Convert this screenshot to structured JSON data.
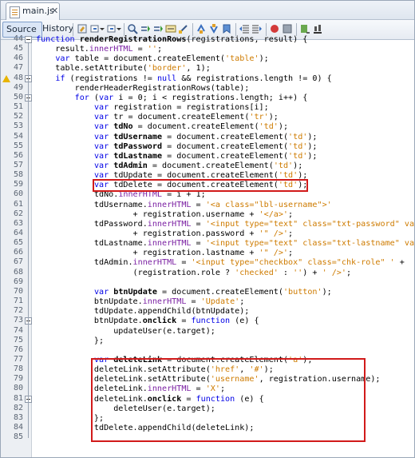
{
  "tab": {
    "filename": "main.js",
    "close": "✕"
  },
  "toolbar": {
    "source_label": "Source",
    "history_label": "History"
  },
  "lines": [
    {
      "n": "44",
      "html": "<span class='kw'>function</span> <span class='fn'>renderRegistrationRows</span>(registrations, result) {"
    },
    {
      "n": "45",
      "html": "    result.<span class='purple'>innerHTML</span> = <span class='str'>''</span>;"
    },
    {
      "n": "46",
      "html": "    <span class='kw'>var</span> table = document.createElement(<span class='str'>'table'</span>);"
    },
    {
      "n": "47",
      "html": "    table.setAttribute(<span class='str'>'border'</span>, 1);"
    },
    {
      "n": "48",
      "html": "    <span class='kw'>if</span> (registrations != <span class='kw'>null</span> &amp;&amp; registrations.length != 0) {"
    },
    {
      "n": "49",
      "html": "        renderHeaderRegistrationRows(table);"
    },
    {
      "n": "50",
      "html": "        <span class='kw'>for</span> (<span class='kw'>var</span> i = 0; i &lt; registrations.length; i++) {"
    },
    {
      "n": "51",
      "html": "            <span class='kw'>var</span> registration = registrations[i];"
    },
    {
      "n": "52",
      "html": "            <span class='kw'>var</span> tr = document.createElement(<span class='str'>'tr'</span>);"
    },
    {
      "n": "53",
      "html": "            <span class='kw'>var</span> <span class='bold'>tdNo</span> = document.createElement(<span class='str'>'td'</span>);"
    },
    {
      "n": "54",
      "html": "            <span class='kw'>var</span> <span class='bold'>tdUsername</span> = document.createElement(<span class='str'>'td'</span>);"
    },
    {
      "n": "55",
      "html": "            <span class='kw'>var</span> <span class='bold'>tdPassword</span> = document.createElement(<span class='str'>'td'</span>);"
    },
    {
      "n": "56",
      "html": "            <span class='kw'>var</span> <span class='bold'>tdLastname</span> = document.createElement(<span class='str'>'td'</span>);"
    },
    {
      "n": "57",
      "html": "            <span class='kw'>var</span> <span class='bold'>tdAdmin</span> = document.createElement(<span class='str'>'td'</span>);"
    },
    {
      "n": "58",
      "html": "            <span class='kw'>var</span> tdUpdate = document.createElement(<span class='str'>'td'</span>);"
    },
    {
      "n": "59",
      "html": "            <span class='kw'>var</span> tdDelete = document.createElement(<span class='str'>'td'</span>);"
    },
    {
      "n": "60",
      "html": "            tdNo.<span class='purple'>innerHTML</span> = i + 1;"
    },
    {
      "n": "61",
      "html": "            tdUsername.<span class='purple'>innerHTML</span> = <span class='str'>'&lt;a class=\"lbl-username\"&gt;'</span>"
    },
    {
      "n": "62",
      "html": "                    + registration.username + <span class='str'>'&lt;/a&gt;'</span>;"
    },
    {
      "n": "63",
      "html": "            tdPassword.<span class='purple'>innerHTML</span> = <span class='str'>'&lt;input type=\"text\" class=\"txt-password\" value=\"'</span>"
    },
    {
      "n": "64",
      "html": "                    + registration.password + <span class='str'>'\" /&gt;'</span>;"
    },
    {
      "n": "65",
      "html": "            tdLastname.<span class='purple'>innerHTML</span> = <span class='str'>'&lt;input type=\"text\" class=\"txt-lastname\" value=\"'</span>"
    },
    {
      "n": "66",
      "html": "                    + registration.lastname + <span class='str'>'\" /&gt;'</span>;"
    },
    {
      "n": "67",
      "html": "            tdAdmin.<span class='purple'>innerHTML</span> = <span class='str'>'&lt;input type=\"checkbox\" class=\"chk-role\" '</span> +"
    },
    {
      "n": "68",
      "html": "                    (registration.role ? <span class='str'>'checked'</span> : <span class='str'>''</span>) + <span class='str'>' /&gt;'</span>;"
    },
    {
      "n": "69",
      "html": ""
    },
    {
      "n": "70",
      "html": "            <span class='kw'>var</span> <span class='bold'>btnUpdate</span> = document.createElement(<span class='str'>'button'</span>);"
    },
    {
      "n": "71",
      "html": "            btnUpdate.<span class='purple'>innerHTML</span> = <span class='str'>'Update'</span>;"
    },
    {
      "n": "72",
      "html": "            tdUpdate.appendChild(btnUpdate);"
    },
    {
      "n": "73",
      "html": "            btnUpdate.<span class='bold'>onclick</span> = <span class='kw'>function</span> (e) {"
    },
    {
      "n": "74",
      "html": "                updateUser(e.target);"
    },
    {
      "n": "75",
      "html": "            };"
    },
    {
      "n": "76",
      "html": ""
    },
    {
      "n": "77",
      "html": "            <span class='kw'>var</span> <span class='bold'>deleteLink</span> = document.createElement(<span class='str'>'a'</span>);"
    },
    {
      "n": "78",
      "html": "            deleteLink.setAttribute(<span class='str'>'href'</span>, <span class='str'>'#'</span>);"
    },
    {
      "n": "79",
      "html": "            deleteLink.setAttribute(<span class='str'>'username'</span>, registration.username);"
    },
    {
      "n": "80",
      "html": "            deleteLink.<span class='purple'>innerHTML</span> = <span class='str'>'X'</span>;"
    },
    {
      "n": "81",
      "html": "            deleteLink.<span class='bold'>onclick</span> = <span class='kw'>function</span> (e) {"
    },
    {
      "n": "82",
      "html": "                deleteUser(e.target);"
    },
    {
      "n": "83",
      "html": "            };"
    },
    {
      "n": "84",
      "html": "            tdDelete.appendChild(deleteLink);"
    },
    {
      "n": "85",
      "html": ""
    }
  ]
}
